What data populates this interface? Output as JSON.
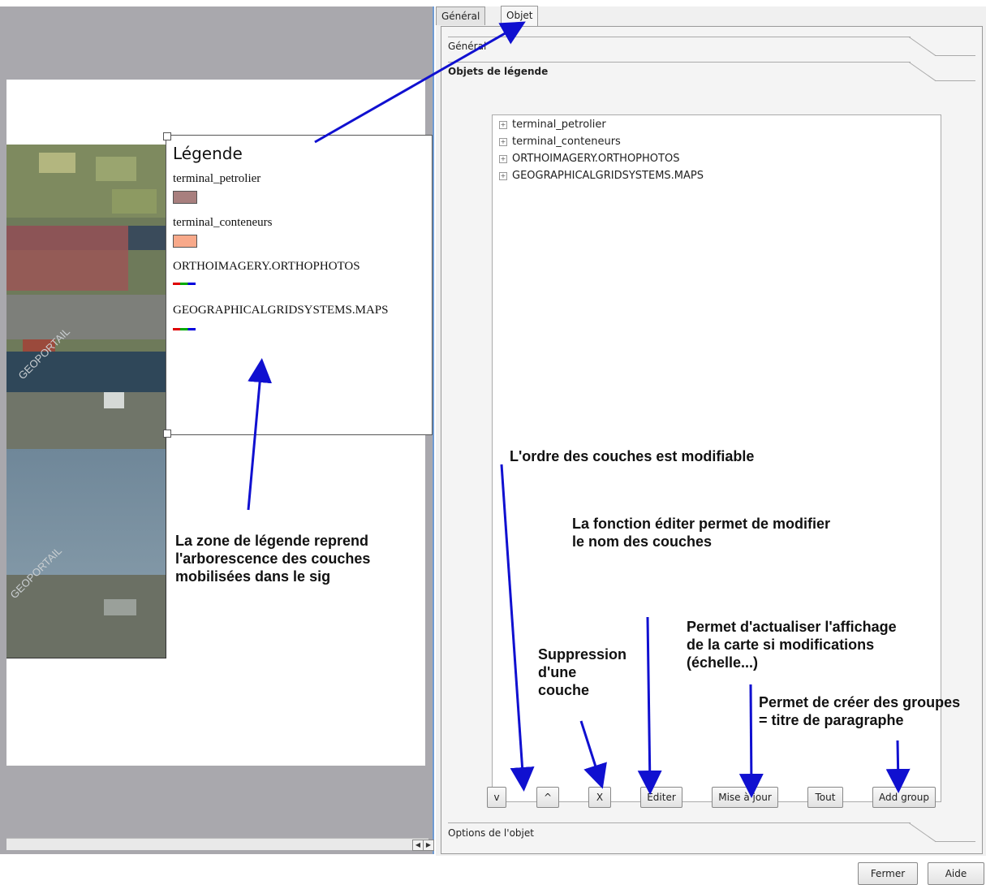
{
  "tabs": [
    {
      "label": "Général"
    },
    {
      "label": "Objet"
    }
  ],
  "sections": {
    "general": "Général",
    "legend_items": "Objets de légende",
    "item_options": "Options de l'objet"
  },
  "tree_items": [
    {
      "label": "terminal_petrolier"
    },
    {
      "label": "terminal_conteneurs"
    },
    {
      "label": "ORTHOIMAGERY.ORTHOPHOTOS"
    },
    {
      "label": "GEOGRAPHICALGRIDSYSTEMS.MAPS"
    }
  ],
  "buttons": {
    "down": "v",
    "up": "^",
    "remove": "X",
    "edit": "Éditer",
    "update": "Mise à jour",
    "all": "Tout",
    "add_group": "Add group",
    "close": "Fermer",
    "help": "Aide"
  },
  "legend": {
    "title": "Légende",
    "items": [
      {
        "label": "terminal_petrolier",
        "type": "polygon",
        "color": "#a87f7e"
      },
      {
        "label": "terminal_conteneurs",
        "type": "polygon",
        "color": "#f8a98a"
      },
      {
        "label": "ORTHOIMAGERY.ORTHOPHOTOS",
        "type": "raster"
      },
      {
        "label": "GEOGRAPHICALGRIDSYSTEMS.MAPS",
        "type": "raster"
      }
    ]
  },
  "map": {
    "watermark": "GEOPORTAIL"
  },
  "annotations": {
    "legend_zone": [
      "La zone de légende reprend",
      "l'arborescence des couches",
      "mobilisées dans le sig"
    ],
    "order": "L'ordre des couches est modifiable",
    "edit_fn": [
      "La fonction éditer permet de modifier",
      "le nom des couches"
    ],
    "delete": [
      "Suppression",
      "d'une",
      "couche"
    ],
    "refresh": [
      "Permet d'actualiser l'affichage",
      "de la carte si modifications",
      "(échelle...)"
    ],
    "groups": [
      "Permet de créer des groupes",
      "= titre de paragraphe"
    ]
  },
  "colors": {
    "annotation_arrow": "#1010d0",
    "canvas_bg": "#a9a8ad"
  }
}
